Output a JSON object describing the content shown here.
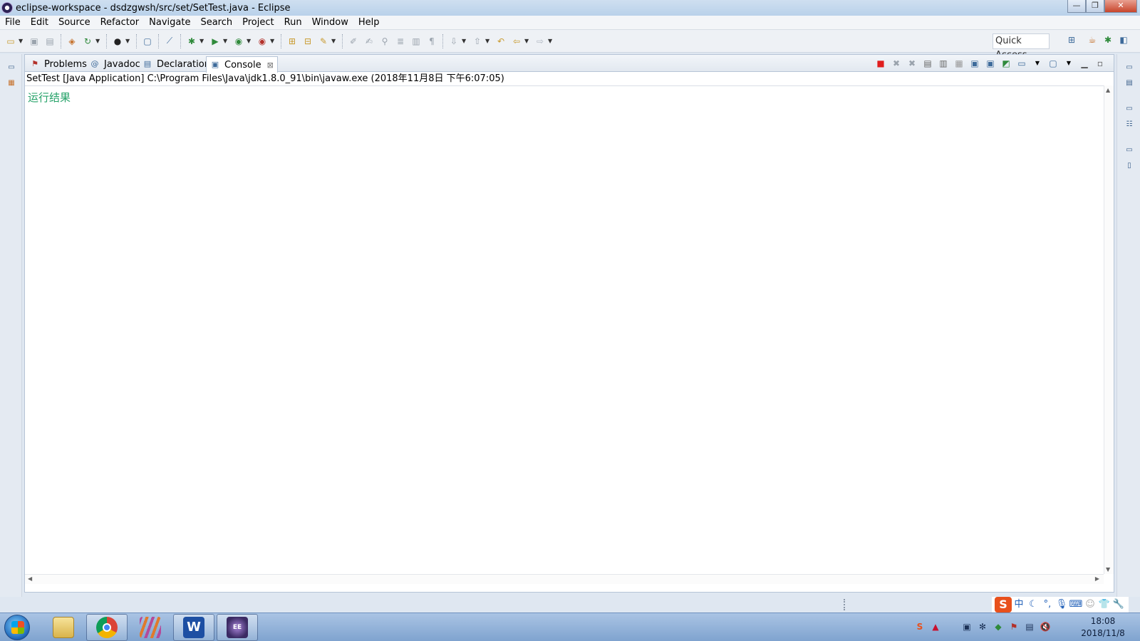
{
  "window": {
    "title": "eclipse-workspace - dsdzgwsh/src/set/SetTest.java - Eclipse",
    "minimize": "—",
    "restore": "❐",
    "close": "✕"
  },
  "menu": [
    "File",
    "Edit",
    "Source",
    "Refactor",
    "Navigate",
    "Search",
    "Project",
    "Run",
    "Window",
    "Help"
  ],
  "toolbar": {
    "quick_access": "Quick Access"
  },
  "view": {
    "tabs": [
      {
        "label": "Problems",
        "icon": "problems-icon"
      },
      {
        "label": "Javadoc",
        "icon": "javadoc-icon"
      },
      {
        "label": "Declaration",
        "icon": "declaration-icon"
      },
      {
        "label": "Console",
        "icon": "console-icon",
        "active": true
      }
    ],
    "console_description": "SetTest [Java Application] C:\\Program Files\\Java\\jdk1.8.0_91\\bin\\javaw.exe (2018年11月8日 下午6:07:05)",
    "console_output": "运行结果",
    "console_output_color": "#26a269",
    "terminate_color": "#e01e1e"
  },
  "taskbar": {
    "apps": [
      "file-explorer",
      "chrome",
      "winrar",
      "wps-writer",
      "eclipse-java-ee"
    ],
    "clock_time": "18:08",
    "clock_date": "2018/11/8"
  },
  "ime": {
    "logo": "S",
    "mode": "中"
  }
}
